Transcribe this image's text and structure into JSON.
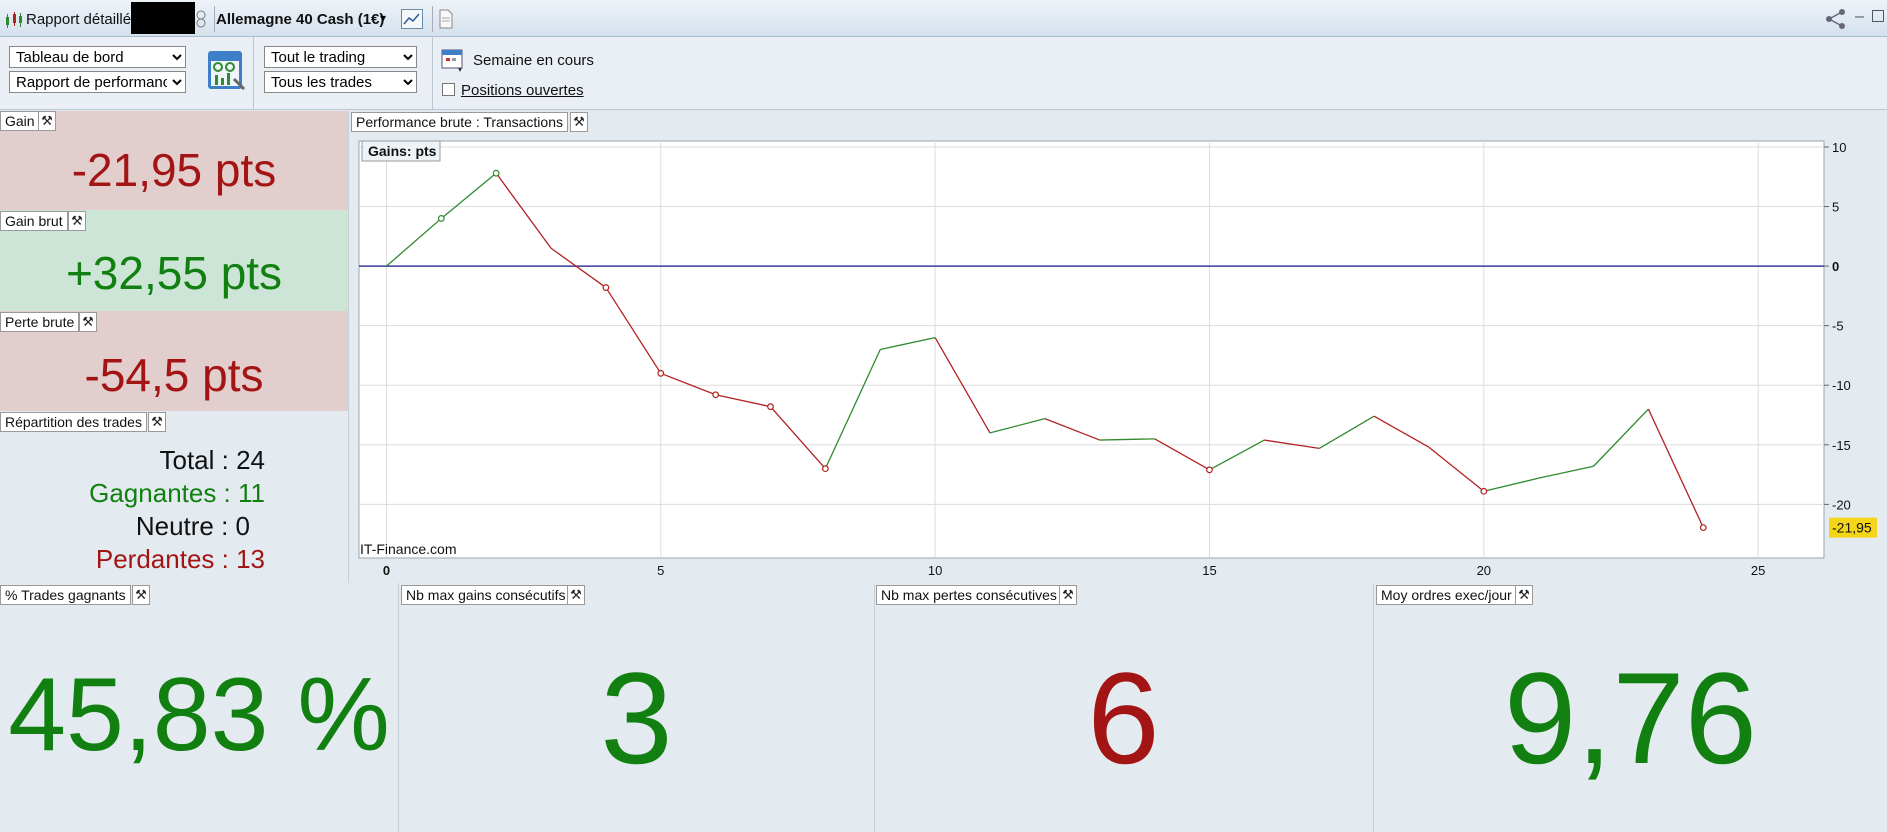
{
  "titlebar": {
    "title": "Rapport détaillé",
    "instrument": "Allemagne 40 Cash (1€)"
  },
  "toolbar": {
    "view_select": "Tableau de bord",
    "report_select": "Rapport de performance",
    "trading_select": "Tout le trading",
    "trades_select": "Tous les trades",
    "period_label": "Semaine en cours",
    "open_positions_label": "Positions ouvertes"
  },
  "left": {
    "gain": {
      "tab": "Gain",
      "value": "-21,95 pts",
      "color": "#a31515",
      "bg": "#e3cece"
    },
    "gain_brut": {
      "tab": "Gain brut",
      "value": "+32,55 pts",
      "color": "#118011",
      "bg": "#cde5d6"
    },
    "perte_brute": {
      "tab": "Perte brute",
      "value": "-54,5 pts",
      "color": "#a31515",
      "bg": "#e3cece"
    },
    "repartition": {
      "tab": "Répartition des trades",
      "total": "Total : 24",
      "gagnantes": "Gagnantes : 11",
      "neutre": "Neutre : 0",
      "perdantes": "Perdantes : 13"
    }
  },
  "chart_panel": {
    "tab": "Performance brute : Transactions",
    "watermark": "IT-Finance.com",
    "last_value_label": "-21,95"
  },
  "chart_data": {
    "type": "line",
    "title": "Gains: pts",
    "x": [
      0,
      1,
      2,
      3,
      4,
      5,
      6,
      7,
      8,
      9,
      10,
      11,
      12,
      13,
      14,
      15,
      16,
      17,
      18,
      19,
      20,
      21,
      22,
      23,
      24
    ],
    "values": [
      0,
      4,
      7.8,
      1.5,
      -1.8,
      -9,
      -10.8,
      -11.8,
      -17,
      -7,
      -6,
      -14,
      -12.8,
      -14.6,
      -14.5,
      -17.1,
      -14.6,
      -15.3,
      -12.6,
      -15.2,
      -18.9,
      -17.8,
      -16.8,
      -12,
      -21.95
    ],
    "markers_at": [
      1,
      2,
      4,
      5,
      6,
      7,
      8,
      15,
      20,
      24
    ],
    "xlim": [
      -0.5,
      26.2
    ],
    "ylim": [
      -24.5,
      10.5
    ],
    "xticks": [
      0,
      5,
      10,
      15,
      20,
      25
    ],
    "yticks": [
      10,
      5,
      0,
      -5,
      -10,
      -15,
      -20
    ],
    "xlabel": "",
    "ylabel": "",
    "grid": true,
    "up_color": "#2e8b2e",
    "down_color": "#b22222",
    "zero_line_color": "#3a3a9a"
  },
  "kpis": [
    {
      "tab": "% Trades gagnants",
      "value": "45,83 %",
      "color": "#118011"
    },
    {
      "tab": "Nb max gains consécutifs",
      "value": "3",
      "color": "#118011"
    },
    {
      "tab": "Nb max pertes consécutives",
      "value": "6",
      "color": "#a31515"
    },
    {
      "tab": "Moy ordres exec/jour",
      "value": "9,76",
      "color": "#118011"
    }
  ]
}
